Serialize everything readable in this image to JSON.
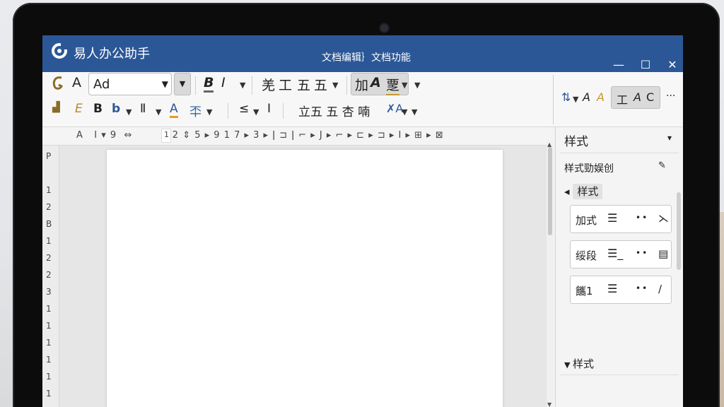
{
  "app": {
    "name": "易人办公助手",
    "doc_title": "文档编辑｝文档功能",
    "title_bar_color": "#2b5797"
  },
  "window_controls": {
    "minimize": "—",
    "maximize": "☐",
    "close": "✕"
  },
  "ribbon": {
    "row1": {
      "font_a": "A",
      "font_value": "Ad",
      "bold": "B",
      "italic": "I",
      "t1": "羌",
      "t2": "工",
      "t3": "五",
      "t4": "五",
      "group_a": "加",
      "group_b": "A",
      "group_c": "覂"
    },
    "row2": {
      "e": "E",
      "b": "B",
      "b2": "b",
      "r": "Ⅱ",
      "color_a": "A",
      "fmt": "㔻",
      "s": "≤",
      "i": "I",
      "lite": "立五 五 杏 喃",
      "xa": "✗A"
    },
    "side": {
      "sort": "⇅",
      "a1": "A",
      "a2": "A",
      "t": "工",
      "a3": "A",
      "c": "C",
      "more": "···"
    }
  },
  "ruler": {
    "text": "A   I ▾ 9  ⇔           2 ⇕ 5 ▸ 9 1 7 ▸ 3 ▸ ǀ ⊐ ǀ ⌐ ▸ J ▸ ⌐ ▸ ⊏ ▸ ⊐ ▸ I ▸ ⊞ ▸ ⊠",
    "marker": "1"
  },
  "left_ruler": {
    "labels": [
      "P",
      "1",
      "2",
      "B",
      "1",
      "2",
      "2",
      "3",
      "1",
      "1",
      "1",
      "1",
      "1",
      "1",
      "1"
    ]
  },
  "style_panel": {
    "title": "样式",
    "pin": "▾",
    "subtitle": "样式勁娱创",
    "group_label": "样式",
    "cards": [
      {
        "name": "加式",
        "action": "⋋"
      },
      {
        "name": "绥段",
        "action": "▤"
      },
      {
        "name": "䭨1",
        "action": "∕"
      }
    ],
    "group2_label": "样式"
  }
}
